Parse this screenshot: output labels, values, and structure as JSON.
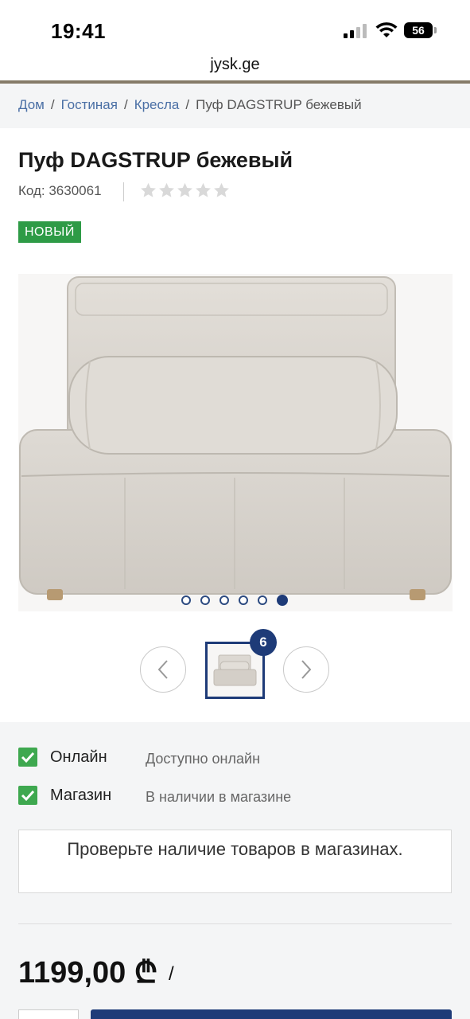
{
  "status_bar": {
    "time": "19:41",
    "battery": "56",
    "icons": [
      "signal-icon",
      "wifi-icon",
      "battery-icon"
    ]
  },
  "browser": {
    "url": "jysk.ge"
  },
  "breadcrumb": {
    "items": [
      "Дом",
      "Гостиная",
      "Кресла"
    ],
    "separator": "/",
    "current": "Пуф DAGSTRUP бежевый"
  },
  "product": {
    "title": "Пуф DAGSTRUP бежевый",
    "code": "Код: 3630061",
    "rating": 0,
    "rating_max": 5,
    "badge": "НОВЫЙ"
  },
  "gallery": {
    "slides": 6,
    "active_slide": 6,
    "thumbnail_count": "6"
  },
  "availability": {
    "rows": [
      {
        "label": "Онлайн",
        "value": "Доступно онлайн"
      },
      {
        "label": "Магазин",
        "value": "В наличии в магазине"
      }
    ],
    "check_stores_button": "Проверьте наличие товаров в магазинах."
  },
  "price": {
    "amount": "1199,00",
    "currency": "₾",
    "suffix": "/"
  },
  "colors": {
    "brand_blue": "#1e3b78",
    "link_blue": "#4a6fa5",
    "new_badge_green": "#2e9b46",
    "check_green": "#3ea84f",
    "header_divider": "#857b68"
  }
}
